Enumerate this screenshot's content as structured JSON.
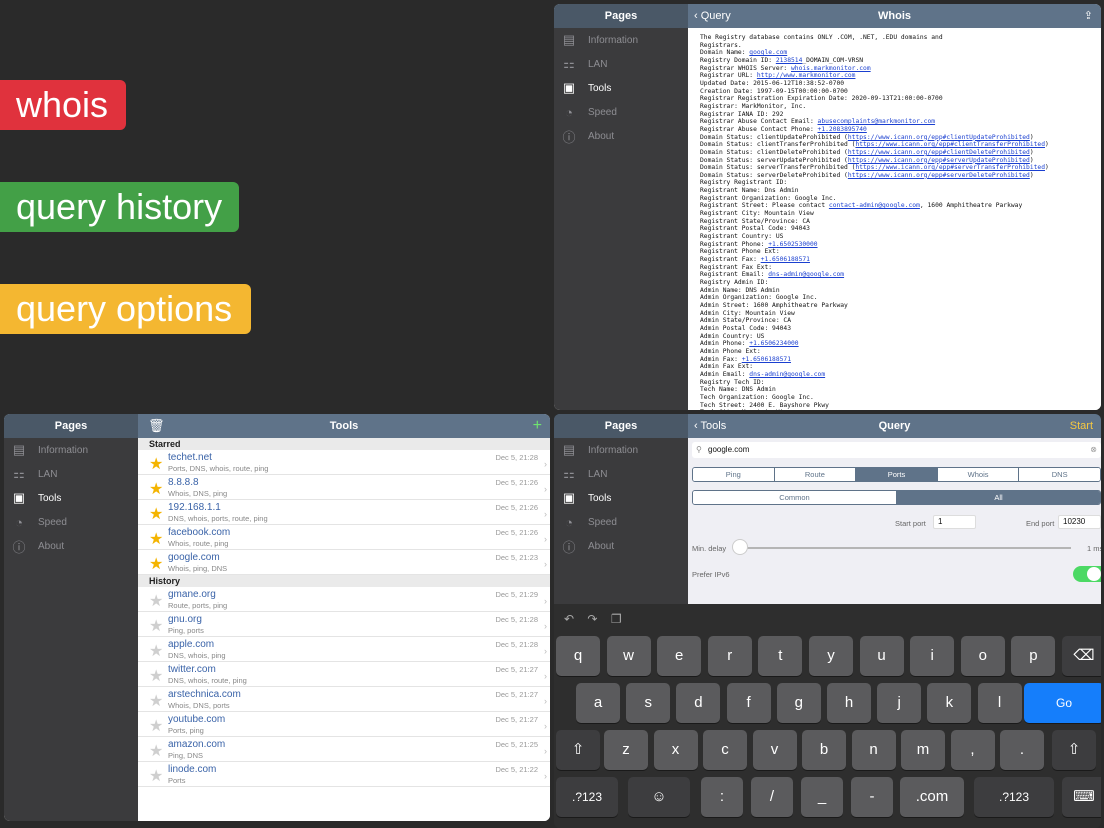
{
  "banners": {
    "whois": "whois",
    "history": "query history",
    "options": "query options"
  },
  "sidebar": {
    "title": "Pages",
    "items": [
      {
        "label": "Information",
        "icon": "document-icon"
      },
      {
        "label": "LAN",
        "icon": "network-icon"
      },
      {
        "label": "Tools",
        "icon": "toolbox-icon"
      },
      {
        "label": "Speed",
        "icon": "speedometer-icon"
      },
      {
        "label": "About",
        "icon": "info-icon"
      }
    ]
  },
  "whois_panel": {
    "back": "Query",
    "title": "Whois",
    "lines": [
      "The Registry database contains ONLY .COM, .NET, .EDU domains and",
      "Registrars.",
      "Domain Name: [google.com]",
      "Registry Domain ID: [2138514]_DOMAIN_COM-VRSN",
      "Registrar WHOIS Server: [whois.markmonitor.com]",
      "Registrar URL: [http://www.markmonitor.com]",
      "Updated Date: 2015-06-12T10:38:52-0700",
      "Creation Date: 1997-09-15T00:00:00-0700",
      "Registrar Registration Expiration Date: 2020-09-13T21:00:00-0700",
      "Registrar: MarkMonitor, Inc.",
      "Registrar IANA ID: 292",
      "Registrar Abuse Contact Email: [abusecomplaints@markmonitor.com]",
      "Registrar Abuse Contact Phone: [+1.2083895740]",
      "Domain Status: clientUpdateProhibited ([https://www.icann.org/epp#clientUpdateProhibited])",
      "Domain Status: clientTransferProhibited ([https://www.icann.org/epp#clientTransferProhibited])",
      "Domain Status: clientDeleteProhibited ([https://www.icann.org/epp#clientDeleteProhibited])",
      "Domain Status: serverUpdateProhibited ([https://www.icann.org/epp#serverUpdateProhibited])",
      "Domain Status: serverTransferProhibited ([https://www.icann.org/epp#serverTransferProhibited])",
      "Domain Status: serverDeleteProhibited ([https://www.icann.org/epp#serverDeleteProhibited])",
      "Registry Registrant ID:",
      "Registrant Name: Dns Admin",
      "Registrant Organization: Google Inc.",
      "Registrant Street: Please contact [contact-admin@google.com], 1600 Amphitheatre Parkway",
      "Registrant City: Mountain View",
      "Registrant State/Province: CA",
      "Registrant Postal Code: 94043",
      "Registrant Country: US",
      "Registrant Phone: [+1.6502530000]",
      "Registrant Phone Ext:",
      "Registrant Fax: [+1.6506188571]",
      "Registrant Fax Ext:",
      "Registrant Email: [dns-admin@google.com]",
      "Registry Admin ID:",
      "Admin Name: DNS Admin",
      "Admin Organization: Google Inc.",
      "Admin Street: 1600 Amphitheatre Parkway",
      "Admin City: Mountain View",
      "Admin State/Province: CA",
      "Admin Postal Code: 94043",
      "Admin Country: US",
      "Admin Phone: [+1.6506234000]",
      "Admin Phone Ext:",
      "Admin Fax: [+1.6506188571]",
      "Admin Fax Ext:",
      "Admin Email: [dns-admin@google.com]",
      "Registry Tech ID:",
      "Tech Name: DNS Admin",
      "Tech Organization: Google Inc.",
      "Tech Street: 2400 E. Bayshore Pkwy",
      "Tech City: Mountain View"
    ]
  },
  "tools_panel": {
    "title": "Tools",
    "starred_header": "Starred",
    "history_header": "History",
    "starred": [
      {
        "host": "techet.net",
        "tags": "Ports, DNS, whois, route, ping",
        "date": "Dec 5, 21:28"
      },
      {
        "host": "8.8.8.8",
        "tags": "Whois, DNS, ping",
        "date": "Dec 5, 21:26"
      },
      {
        "host": "192.168.1.1",
        "tags": "DNS, whois, ports, route, ping",
        "date": "Dec 5, 21:26"
      },
      {
        "host": "facebook.com",
        "tags": "Whois, route, ping",
        "date": "Dec 5, 21:26"
      },
      {
        "host": "google.com",
        "tags": "Whois, ping, DNS",
        "date": "Dec 5, 21:23"
      }
    ],
    "history": [
      {
        "host": "gmane.org",
        "tags": "Route, ports, ping",
        "date": "Dec 5, 21:29"
      },
      {
        "host": "gnu.org",
        "tags": "Ping, ports",
        "date": "Dec 5, 21:28"
      },
      {
        "host": "apple.com",
        "tags": "DNS, whois, ping",
        "date": "Dec 5, 21:28"
      },
      {
        "host": "twitter.com",
        "tags": "DNS, whois, route, ping",
        "date": "Dec 5, 21:27"
      },
      {
        "host": "arstechnica.com",
        "tags": "Whois, DNS, ports",
        "date": "Dec 5, 21:27"
      },
      {
        "host": "youtube.com",
        "tags": "Ports, ping",
        "date": "Dec 5, 21:27"
      },
      {
        "host": "amazon.com",
        "tags": "Ping, DNS",
        "date": "Dec 5, 21:25"
      },
      {
        "host": "linode.com",
        "tags": "Ports",
        "date": "Dec 5, 21:22"
      }
    ]
  },
  "query_panel": {
    "back": "Tools",
    "title": "Query",
    "start": "Start",
    "search_value": "google.com",
    "tabs": [
      "Ping",
      "Route",
      "Ports",
      "Whois",
      "DNS"
    ],
    "active_tab": "Ports",
    "port_modes": [
      "Common",
      "All"
    ],
    "active_mode": "All",
    "start_port_label": "Start port",
    "start_port_value": "1",
    "end_port_label": "End port",
    "end_port_value": "10230",
    "min_delay_label": "Min. delay",
    "min_delay_value": "1 ms",
    "ipv6_label": "Prefer IPv6"
  },
  "keyboard": {
    "row1": [
      "q",
      "w",
      "e",
      "r",
      "t",
      "y",
      "u",
      "i",
      "o",
      "p"
    ],
    "row2": [
      "a",
      "s",
      "d",
      "f",
      "g",
      "h",
      "j",
      "k",
      "l"
    ],
    "row3": [
      "z",
      "x",
      "c",
      "v",
      "b",
      "n",
      "m",
      ",",
      "."
    ],
    "go": "Go",
    "num": ".?123",
    "colon": ":",
    "slash": "/",
    "underscore": "_",
    "dash": "-",
    "dotcom": ".com"
  }
}
